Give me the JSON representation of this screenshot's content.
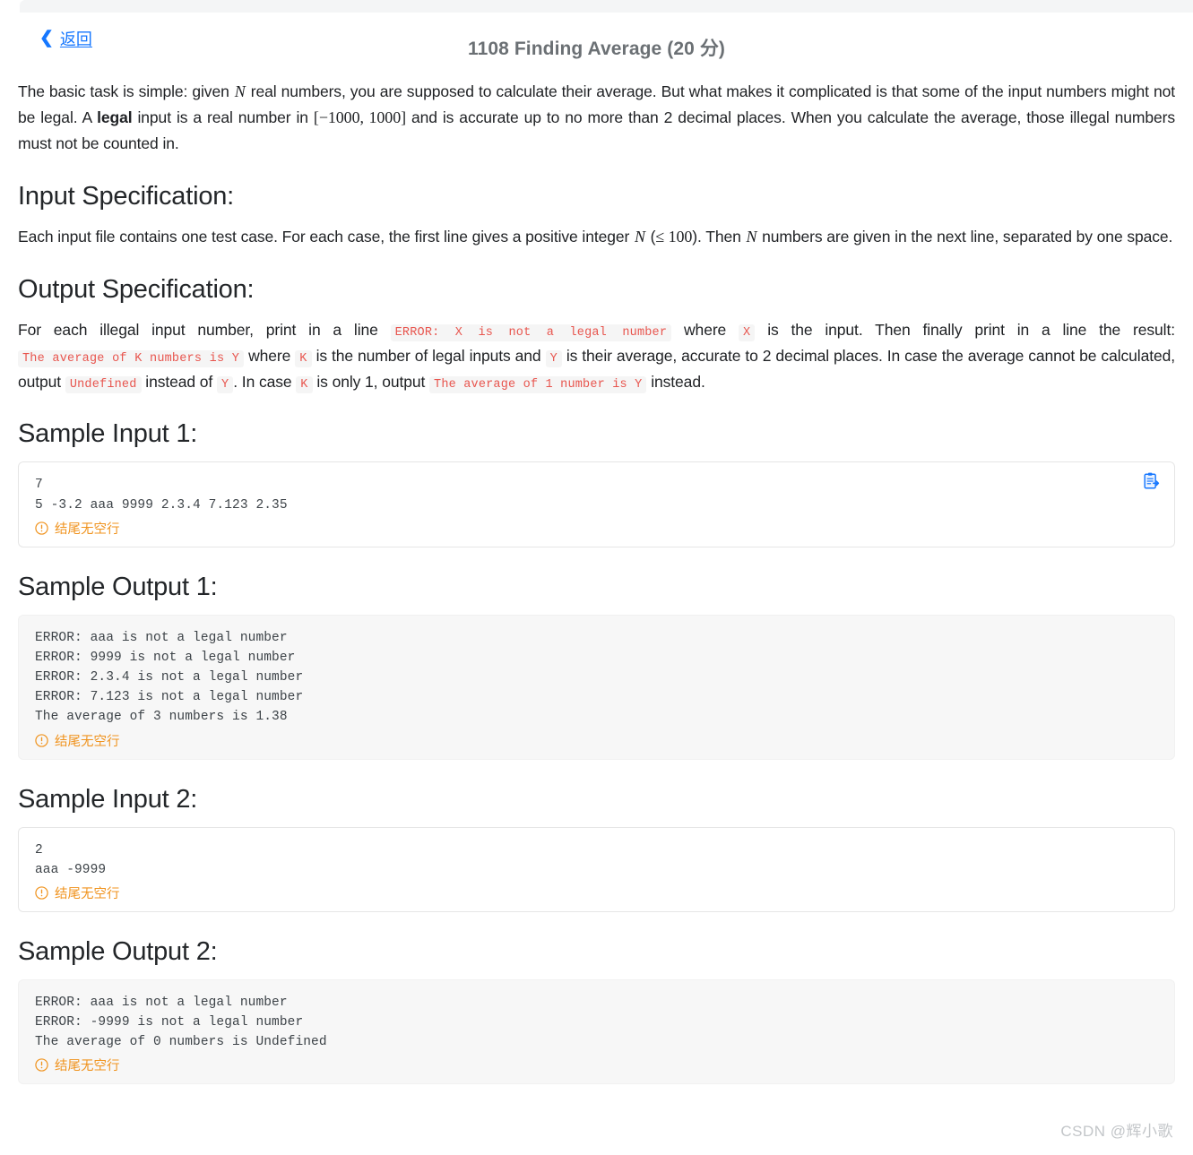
{
  "header": {
    "back_label": "返回",
    "back_icon": "chevron-left-icon",
    "title": "1108 Finding Average (20 分)"
  },
  "intro": {
    "t1": "The basic task is simple: given ",
    "v1": "N",
    "t2": " real numbers, you are supposed to calculate their average. But what makes it complicated is that some of the input numbers might not be legal. A ",
    "strong": "legal",
    "t3": " input is a real number in ",
    "range": "[−1000, 1000]",
    "t4": " and is accurate up to no more than 2 decimal places. When you calculate the average, those illegal numbers must not be counted in."
  },
  "input_spec": {
    "heading": "Input Specification:",
    "t1": "Each input file contains one test case. For each case, the first line gives a positive integer ",
    "v1": "N",
    "t2": " (",
    "le": "≤ 100",
    "t3": "). Then ",
    "v2": "N",
    "t4": " numbers are given in the next line, separated by one space."
  },
  "output_spec": {
    "heading": "Output Specification:",
    "t1": "For each illegal input number, print in a line ",
    "c1": "ERROR: X is not a legal number",
    "t2": " where ",
    "c2": "X",
    "t3": " is the input. Then finally print in a line the result: ",
    "c3": "The average of K numbers is Y",
    "t4": " where ",
    "c4": "K",
    "t5": " is the number of legal inputs and ",
    "c5": "Y",
    "t6": " is their average, accurate to 2 decimal places. In case the average cannot be calculated, output ",
    "c6": "Undefined",
    "t7": " instead of ",
    "c7": "Y",
    "t8": ". In case ",
    "c8": "K",
    "t9": " is only 1, output ",
    "c9": "The average of 1 number is Y",
    "t10": " instead."
  },
  "samples": [
    {
      "heading": "Sample Input 1:",
      "kind": "input",
      "code": "7\n5 -3.2 aaa 9999 2.3.4 7.123 2.35",
      "note": "结尾无空行",
      "has_copy": true,
      "copy_icon": "clipboard-copy-icon"
    },
    {
      "heading": "Sample Output 1:",
      "kind": "output",
      "code": "ERROR: aaa is not a legal number\nERROR: 9999 is not a legal number\nERROR: 2.3.4 is not a legal number\nERROR: 7.123 is not a legal number\nThe average of 3 numbers is 1.38",
      "note": "结尾无空行",
      "has_copy": false,
      "copy_icon": ""
    },
    {
      "heading": "Sample Input 2:",
      "kind": "input",
      "code": "2\naaa -9999",
      "note": "结尾无空行",
      "has_copy": false,
      "copy_icon": ""
    },
    {
      "heading": "Sample Output 2:",
      "kind": "output",
      "code": "ERROR: aaa is not a legal number\nERROR: -9999 is not a legal number\nThe average of 0 numbers is Undefined",
      "note": "结尾无空行",
      "has_copy": false,
      "copy_icon": ""
    }
  ],
  "watermark": "CSDN @辉小歌",
  "colors": {
    "link": "#1677ff",
    "title": "#6b7074",
    "code_text": "#e8554e",
    "warn": "#f0931e",
    "output_bg": "#f7f7f7"
  }
}
